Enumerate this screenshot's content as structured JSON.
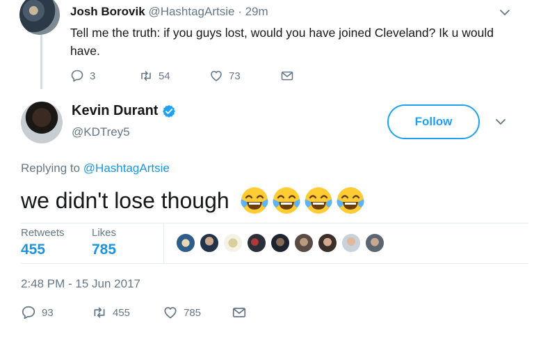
{
  "reply_tweet": {
    "author_name": "Josh Borovik",
    "author_handle": "@HashtagArtsie",
    "time_sep": " · ",
    "time": "29m",
    "text": "Tell me the truth: if you guys lost, would you have joined Cleveland? Ik u would have.",
    "actions": {
      "replies": "3",
      "retweets": "54",
      "likes": "73"
    },
    "icons": [
      "reply-icon",
      "retweet-icon",
      "like-icon",
      "message-icon",
      "chevron-down-icon"
    ]
  },
  "main_tweet": {
    "author_name": "Kevin Durant",
    "author_handle": "@KDTrey5",
    "follow_label": "Follow",
    "replying_prefix": "Replying to ",
    "replying_to": "@HashtagArtsie",
    "text": "we didn't lose though",
    "emoji": [
      "face-with-tears-of-joy",
      "face-with-tears-of-joy",
      "face-with-tears-of-joy",
      "face-with-tears-of-joy"
    ],
    "stats": {
      "retweets_label": "Retweets",
      "retweets_value": "455",
      "likes_label": "Likes",
      "likes_value": "785"
    },
    "likers_count": 9,
    "timestamp": "2:48 PM - 15 Jun 2017",
    "actions": {
      "replies": "93",
      "retweets": "455",
      "likes": "785"
    }
  },
  "colors": {
    "accent": "#1da1f2",
    "link": "#1b95e0",
    "text_primary": "#14171a",
    "text_secondary": "#657786",
    "divider": "#e6ecf0"
  }
}
